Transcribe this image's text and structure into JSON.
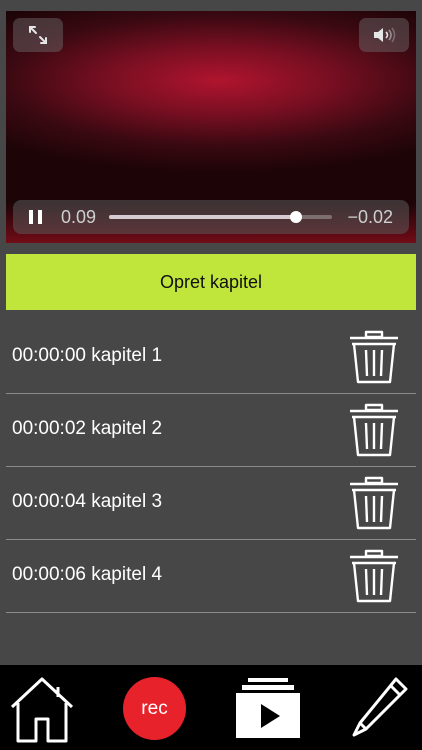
{
  "player": {
    "expand_icon": "expand-arrows-icon",
    "volume_icon": "speaker-icon",
    "pause_icon": "pause-icon",
    "elapsed": "0.09",
    "remaining": "−0.02",
    "progress_fraction": 0.84
  },
  "create_button": {
    "label": "Opret kapitel",
    "color": "#c0e63c"
  },
  "chapters": [
    {
      "label": "00:00:00 kapitel 1"
    },
    {
      "label": "00:00:02 kapitel 2"
    },
    {
      "label": "00:00:04 kapitel 3"
    },
    {
      "label": "00:00:06 kapitel 4"
    }
  ],
  "nav": {
    "home_icon": "home-icon",
    "rec_label": "rec",
    "rec_color": "#e8222a",
    "play_icon": "play-icon",
    "edit_icon": "pencil-icon"
  }
}
